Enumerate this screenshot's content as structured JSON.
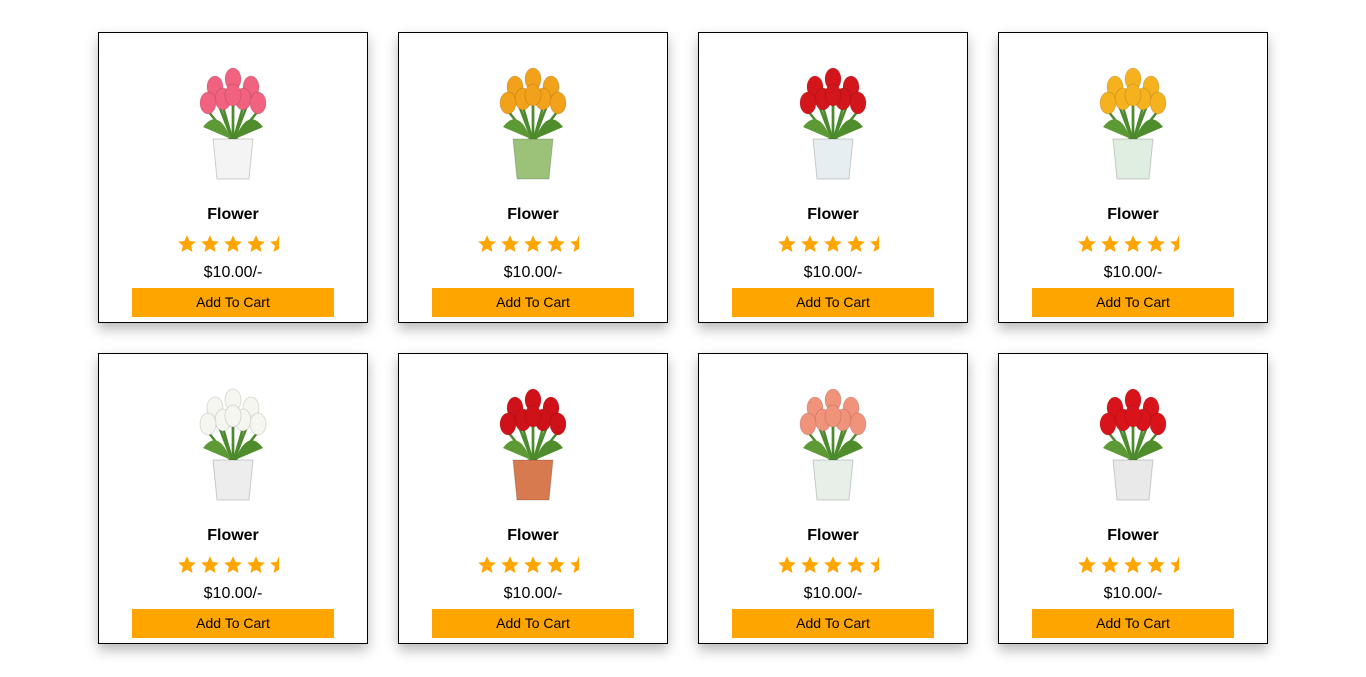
{
  "colors": {
    "accent": "#ffa500",
    "star": "#ffa500",
    "border": "#000000"
  },
  "products": [
    {
      "title": "Flower",
      "rating": 4.5,
      "price": "$10.00/-",
      "button_label": "Add To Cart",
      "image": "pink-tulips-white-vase",
      "flower_color": "#f0627f",
      "vase_color": "#f4f4f4"
    },
    {
      "title": "Flower",
      "rating": 4.5,
      "price": "$10.00/-",
      "button_label": "Add To Cart",
      "image": "mixed-tulips-green-pot",
      "flower_color": "#f2a11a",
      "vase_color": "#9cc27a"
    },
    {
      "title": "Flower",
      "rating": 4.5,
      "price": "$10.00/-",
      "button_label": "Add To Cart",
      "image": "red-tulips-glass-vase",
      "flower_color": "#d2161c",
      "vase_color": "#e6eef2"
    },
    {
      "title": "Flower",
      "rating": 4.5,
      "price": "$10.00/-",
      "button_label": "Add To Cart",
      "image": "yellow-red-tulips-clear-vase",
      "flower_color": "#f5b21e",
      "vase_color": "#dfeee0"
    },
    {
      "title": "Flower",
      "rating": 4.5,
      "price": "$10.00/-",
      "button_label": "Add To Cart",
      "image": "white-tulips-white-vase",
      "flower_color": "#f6f6f0",
      "vase_color": "#ededed"
    },
    {
      "title": "Flower",
      "rating": 4.5,
      "price": "$10.00/-",
      "button_label": "Add To Cart",
      "image": "red-tulip-terracotta-pot",
      "flower_color": "#cf1219",
      "vase_color": "#d77a4f"
    },
    {
      "title": "Flower",
      "rating": 4.5,
      "price": "$10.00/-",
      "button_label": "Add To Cart",
      "image": "mixed-tulips-glass-jar",
      "flower_color": "#f0937a",
      "vase_color": "#e7efe8"
    },
    {
      "title": "Flower",
      "rating": 4.5,
      "price": "$10.00/-",
      "button_label": "Add To Cart",
      "image": "red-tulips-metal-bucket",
      "flower_color": "#d8141a",
      "vase_color": "#e9e9e9"
    }
  ]
}
